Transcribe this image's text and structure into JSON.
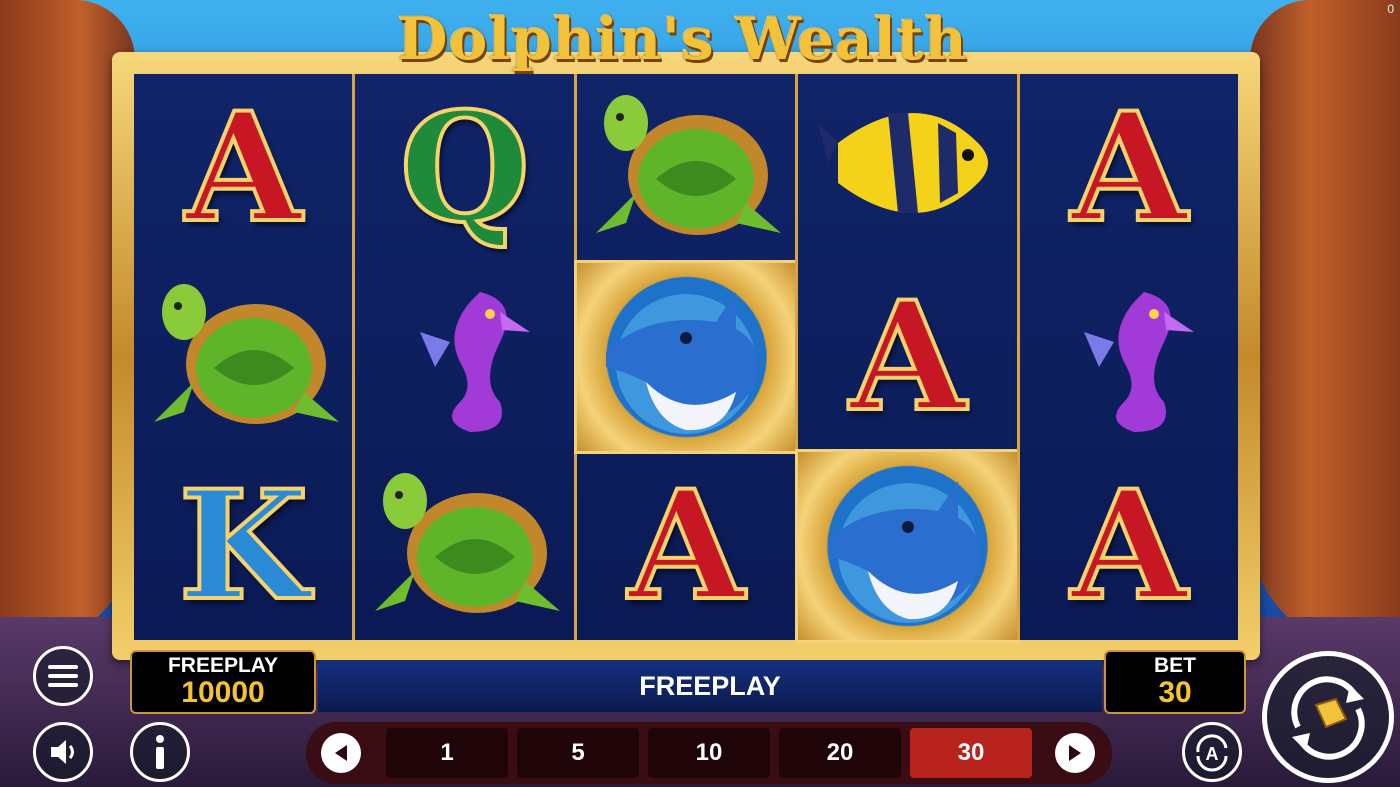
{
  "game": {
    "title": "Dolphin's Wealth",
    "corner_counter": "0"
  },
  "reels": [
    [
      "A",
      "turtle",
      "K"
    ],
    [
      "Q",
      "seahorse",
      "turtle"
    ],
    [
      "turtle",
      "dolphin",
      "A"
    ],
    [
      "angelfish",
      "A",
      "dolphin"
    ],
    [
      "A",
      "seahorse",
      "A"
    ]
  ],
  "highlighted_symbols": [
    [
      2,
      1
    ],
    [
      3,
      2
    ]
  ],
  "balance": {
    "label": "FREEPLAY",
    "value": "10000"
  },
  "message": "FREEPLAY",
  "bet": {
    "label": "BET",
    "value": "30"
  },
  "bet_options": [
    "1",
    "5",
    "10",
    "20",
    "30"
  ],
  "bet_selected": "30",
  "controls": {
    "menu_icon": "menu-icon",
    "sound_icon": "speaker-icon",
    "info_icon": "info-icon",
    "autoplay_icon": "autoplay-icon",
    "spin_icon": "spin-icon",
    "prev_icon": "arrow-left-icon",
    "next_icon": "arrow-right-icon"
  },
  "colors": {
    "gold": "#f2c23a",
    "active_bet": "#b8231d",
    "ace_red": "#c71624"
  }
}
